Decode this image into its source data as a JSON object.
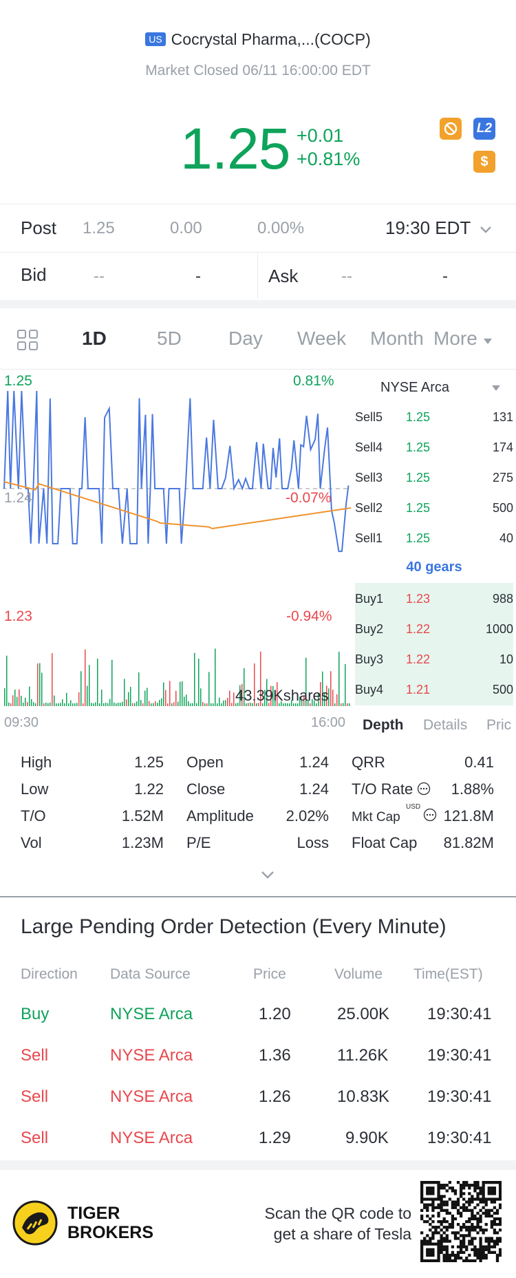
{
  "header": {
    "market_badge": "US",
    "title": "Cocrystal Pharma,...(COCP)",
    "status": "Market Closed 06/11 16:00:00 EDT"
  },
  "quote": {
    "price": "1.25",
    "change": "+0.01",
    "change_pct": "+0.81%",
    "icons": [
      "no-trade-icon",
      "level2-icon",
      "dollar-icon"
    ],
    "level2_label": "L2",
    "dollar_label": "$"
  },
  "post": {
    "label": "Post",
    "price": "1.25",
    "change": "0.00",
    "change_pct": "0.00%",
    "time": "19:30 EDT"
  },
  "bidask": {
    "bid_label": "Bid",
    "bid_price": "--",
    "bid_size": "-",
    "ask_label": "Ask",
    "ask_price": "--",
    "ask_size": "-"
  },
  "tabs": {
    "items": [
      "1D",
      "5D",
      "Day",
      "Week",
      "Month"
    ],
    "more": "More",
    "active": "1D"
  },
  "chart": {
    "y_top_left": "1.25",
    "y_top_right": "0.81%",
    "y_mid_left": "1.24",
    "y_mid_right": "-0.07%",
    "y_bot_left": "1.23",
    "y_bot_right": "-0.94%",
    "volume_label": "43.39Kshares",
    "x_start": "09:30",
    "x_end": "16:00"
  },
  "depth": {
    "exchange": "NYSE Arca",
    "sells": [
      {
        "label": "Sell5",
        "price": "1.25",
        "qty": "131"
      },
      {
        "label": "Sell4",
        "price": "1.25",
        "qty": "174"
      },
      {
        "label": "Sell3",
        "price": "1.25",
        "qty": "275"
      },
      {
        "label": "Sell2",
        "price": "1.25",
        "qty": "500"
      },
      {
        "label": "Sell1",
        "price": "1.25",
        "qty": "40"
      }
    ],
    "gears": "40 gears",
    "buys": [
      {
        "label": "Buy1",
        "price": "1.23",
        "qty": "988"
      },
      {
        "label": "Buy2",
        "price": "1.22",
        "qty": "1000"
      },
      {
        "label": "Buy3",
        "price": "1.22",
        "qty": "10"
      },
      {
        "label": "Buy4",
        "price": "1.21",
        "qty": "500"
      }
    ],
    "tabs": [
      "Depth",
      "Details",
      "Pric"
    ]
  },
  "stats": {
    "high_label": "High",
    "high": "1.25",
    "low_label": "Low",
    "low": "1.22",
    "to_label": "T/O",
    "to": "1.52M",
    "vol_label": "Vol",
    "vol": "1.23M",
    "open_label": "Open",
    "open": "1.24",
    "close_label": "Close",
    "close": "1.24",
    "amp_label": "Amplitude",
    "amp": "2.02%",
    "pe_label": "P/E",
    "pe": "Loss",
    "qrr_label": "QRR",
    "qrr": "0.41",
    "torate_label": "T/O Rate",
    "torate": "1.88%",
    "mktcap_label": "Mkt Cap",
    "mktcap_unit": "USD",
    "mktcap": "121.8M",
    "floatcap_label": "Float Cap",
    "floatcap": "81.82M"
  },
  "pending": {
    "title": "Large Pending Order Detection (Every Minute)",
    "headers": [
      "Direction",
      "Data Source",
      "Price",
      "Volume",
      "Time(EST)"
    ],
    "rows": [
      {
        "dir": "Buy",
        "src": "NYSE Arca",
        "price": "1.20",
        "vol": "25.00K",
        "time": "19:30:41"
      },
      {
        "dir": "Sell",
        "src": "NYSE Arca",
        "price": "1.36",
        "vol": "11.26K",
        "time": "19:30:41"
      },
      {
        "dir": "Sell",
        "src": "NYSE Arca",
        "price": "1.26",
        "vol": "10.83K",
        "time": "19:30:41"
      },
      {
        "dir": "Sell",
        "src": "NYSE Arca",
        "price": "1.29",
        "vol": "9.90K",
        "time": "19:30:41"
      }
    ]
  },
  "footer": {
    "brand_line1": "TIGER",
    "brand_line2": "BROKERS",
    "promo_line1": "Scan the QR code to",
    "promo_line2": "get a share of Tesla"
  },
  "colors": {
    "green": "#0ea35a",
    "red": "#e8484d",
    "blue": "#3a76e0",
    "orange": "#f2a12c",
    "avg_line": "#f0922e"
  }
}
